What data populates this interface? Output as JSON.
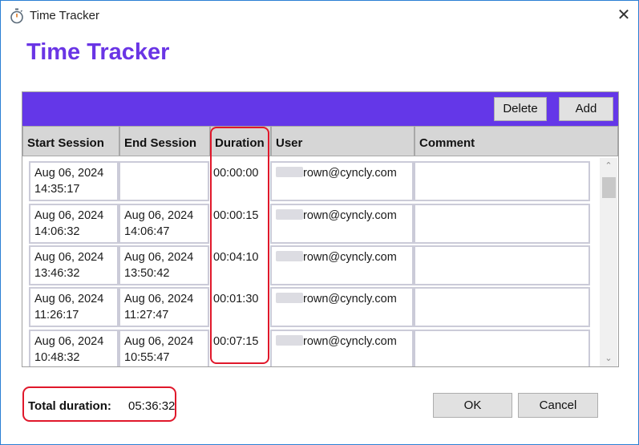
{
  "window": {
    "title": "Time Tracker",
    "close_glyph": "✕",
    "title_icon": "stopwatch-icon"
  },
  "app_title": "Time Tracker",
  "toolbar": {
    "delete_label": "Delete",
    "add_label": "Add",
    "background_color": "#6437e8"
  },
  "columns": [
    "Start Session",
    "End Session",
    "Duration",
    "User",
    "Comment"
  ],
  "rows": [
    {
      "start": [
        "Aug 06, 2024",
        "14:35:17"
      ],
      "end": [
        "",
        ""
      ],
      "duration": "00:00:00",
      "user": "rown@cyncly.com",
      "comment": ""
    },
    {
      "start": [
        "Aug 06, 2024",
        "14:06:32"
      ],
      "end": [
        "Aug 06, 2024",
        "14:06:47"
      ],
      "duration": "00:00:15",
      "user": "rown@cyncly.com",
      "comment": ""
    },
    {
      "start": [
        "Aug 06, 2024",
        "13:46:32"
      ],
      "end": [
        "Aug 06, 2024",
        "13:50:42"
      ],
      "duration": "00:04:10",
      "user": "rown@cyncly.com",
      "comment": ""
    },
    {
      "start": [
        "Aug 06, 2024",
        "11:26:17"
      ],
      "end": [
        "Aug 06, 2024",
        "11:27:47"
      ],
      "duration": "00:01:30",
      "user": "rown@cyncly.com",
      "comment": ""
    },
    {
      "start": [
        "Aug 06, 2024",
        "10:48:32"
      ],
      "end": [
        "Aug 06, 2024",
        "10:55:47"
      ],
      "duration": "00:07:15",
      "user": "rown@cyncly.com",
      "comment": ""
    }
  ],
  "footer": {
    "total_label": "Total duration:",
    "total_value": "05:36:32",
    "ok_label": "OK",
    "cancel_label": "Cancel"
  },
  "colors": {
    "accent": "#6a35e5",
    "highlight": "#e0182b"
  }
}
